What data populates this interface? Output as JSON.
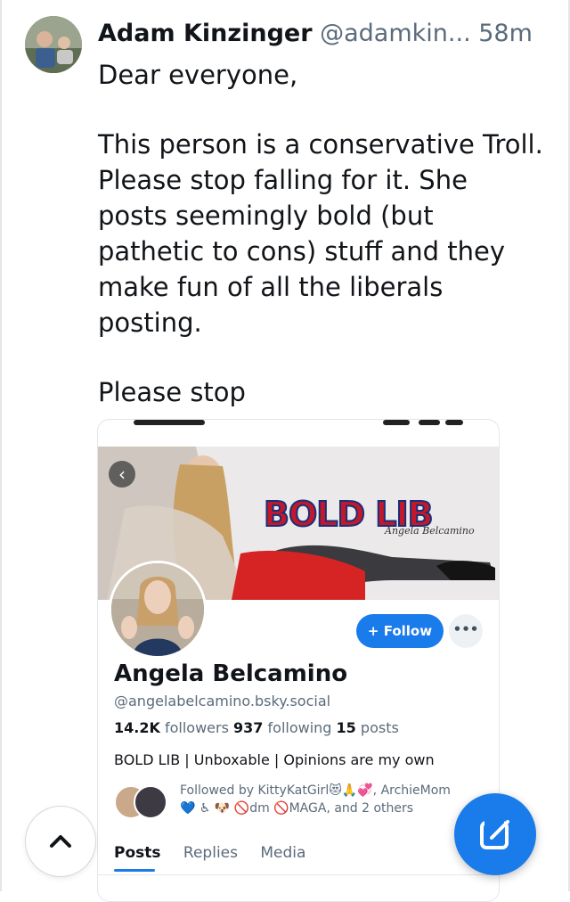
{
  "post": {
    "author_name": "Adam Kinzinger",
    "author_handle": "@adamkin...",
    "time_ago": "58m",
    "body": [
      "Dear everyone,",
      "This person is a conservative Troll.  Please stop falling for it.  She posts seemingly bold (but pathetic to cons) stuff and they make fun of all the liberals posting.",
      "Please stop"
    ]
  },
  "embedded_profile": {
    "banner_text": "BOLD LIB",
    "banner_signature": "Angela Belcamino",
    "back_label": "‹",
    "follow_label": "+ Follow",
    "more_label": "•••",
    "display_name": "Angela Belcamino",
    "handle": "@angelabelcamino.bsky.social",
    "stats": {
      "followers_count": "14.2K",
      "followers_label": "followers",
      "following_count": "937",
      "following_label": "following",
      "posts_count": "15",
      "posts_label": "posts"
    },
    "bio": "BOLD LIB | Unboxable | Opinions are my own",
    "followed_by_line1": "Followed by KittyKatGirl😻🙏💞, ArchieMom",
    "followed_by_line2": "💙 ♿ 🐶 🚫dm 🚫MAGA, and 2 others",
    "tabs": [
      "Posts",
      "Replies",
      "Media"
    ],
    "active_tab": "Posts"
  },
  "colors": {
    "accent": "#1a7bea",
    "muted_text": "#5b6b7c",
    "text": "#111418",
    "banner_title_fill": "#c2182b",
    "banner_title_outline": "#1a2f78"
  },
  "icons": {
    "scroll_top": "chevron-up-icon",
    "compose": "compose-icon"
  }
}
